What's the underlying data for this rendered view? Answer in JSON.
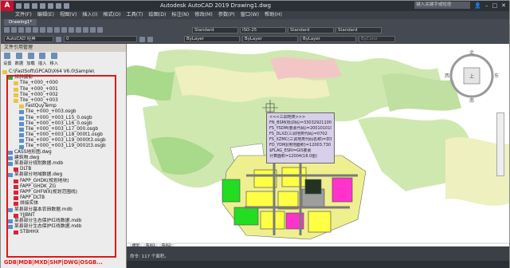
{
  "app": {
    "title": "Autodesk AutoCAD 2019   Drawing1.dwg",
    "search_placeholder": "键入关键字或短语"
  },
  "menu": [
    "文件(F)",
    "编辑(E)",
    "视图(V)",
    "插入(I)",
    "格式(O)",
    "工具(T)",
    "绘图(D)",
    "标注(N)",
    "修改(M)",
    "参数(P)",
    "窗口(W)",
    "帮助(H)"
  ],
  "doc_tab": "Drawing1*",
  "toolbar": {
    "workspace": "AutoCAD 经典",
    "layer": "0",
    "text_style": "Standard",
    "dim_style": "ISO-25",
    "table_style": "Standard",
    "multileader_style": "Standard",
    "color": "ByLayer",
    "linetype": "ByLayer",
    "lineweight": "ByLayer",
    "plot_style": "ByColor"
  },
  "panel": {
    "title": "文件引用管理",
    "tools": [
      "设置",
      "数据",
      "加载",
      "插入",
      "移入"
    ],
    "tree": [
      {
        "text": "C:\\FastSoft\\GPCAD\\X64 V6.0\\Sample\\",
        "type": "folder",
        "indent": 0
      },
      {
        "text": "倾斜摄影",
        "type": "check",
        "indent": 1
      },
      {
        "text": "Tile_+000_+000",
        "type": "folder",
        "indent": 2
      },
      {
        "text": "Tile_+000_+001",
        "type": "folder",
        "indent": 2
      },
      {
        "text": "Tile_+000_+002",
        "type": "folder",
        "indent": 2
      },
      {
        "text": "Tile_+000_+003",
        "type": "folder",
        "indent": 2
      },
      {
        "text": "FastQuyTemp",
        "type": "folder",
        "indent": 3
      },
      {
        "text": "Tile_+000_+003.osgb",
        "type": "file",
        "indent": 3
      },
      {
        "text": "Tile_+000_+003_L15_0.osgb",
        "type": "file",
        "indent": 3
      },
      {
        "text": "Tile_+000_+003_L16_0.osgb",
        "type": "file",
        "indent": 3
      },
      {
        "text": "Tile_+000_+003_L17_000.osgb",
        "type": "file",
        "indent": 3
      },
      {
        "text": "Tile_+000_+003_L18_000t1.osgb",
        "type": "file",
        "indent": 3
      },
      {
        "text": "Tile_+000_+003_L19_0000t3.osgb",
        "type": "file",
        "indent": 3
      },
      {
        "text": "Tile_+000_+003_L19_0001t3.osgb",
        "type": "file",
        "indent": 3
      },
      {
        "text": "CASS地形图.dwg",
        "type": "file",
        "indent": 1
      },
      {
        "text": "建筑物.dwg",
        "type": "file",
        "indent": 1
      },
      {
        "text": "某县部分规划数据.mdb",
        "type": "file",
        "indent": 1
      },
      {
        "text": "DLTB",
        "type": "pin",
        "indent": 2
      },
      {
        "text": "某县部分地域数据.dwg",
        "type": "file",
        "indent": 1
      },
      {
        "text": "FAPP_GHDK(规划地块)",
        "type": "pin",
        "indent": 2
      },
      {
        "text": "FAPP_GHDK_ZG",
        "type": "pin",
        "indent": 2
      },
      {
        "text": "FAPP_GHFWX(规划范围线)",
        "type": "pin",
        "indent": 2
      },
      {
        "text": "FAPP_DLTB",
        "type": "pin",
        "indent": 2
      },
      {
        "text": "拼接实体",
        "type": "pin",
        "indent": 2
      },
      {
        "text": "某县部分基本农田数据.mdb",
        "type": "file",
        "indent": 1
      },
      {
        "text": "YJJBNT",
        "type": "pin",
        "indent": 2
      },
      {
        "text": "某县部分生态保护红线数据.mdb",
        "type": "file",
        "indent": 1
      },
      {
        "text": "某县部分生态保护红线数据.mdb",
        "type": "file",
        "indent": 1
      },
      {
        "text": "STBHHX",
        "type": "pin",
        "indent": 2
      }
    ],
    "footer": "GDB|MDB|MXD|SHP|DWG|OSGB..."
  },
  "popup": {
    "lines": [
      "<<<三调地类>>>",
      "FN_BSM(标识码)=3303292110000914 47",
      "FS_YSDM(要素代码)=2001010100",
      "FS_DLXZ(三调地类代码)=0702",
      "FS_XZMC(三调地类代码名称)=农村宅基地",
      "FD_YDMJ(用地面积)=12003.730",
      "$FLAG_ESRI=GIS要素",
      "计算面积=12004(18.0亩)"
    ]
  },
  "layout_tabs": [
    "模型",
    "布局1",
    "布局2"
  ],
  "command": "命令: 117 个面积。"
}
